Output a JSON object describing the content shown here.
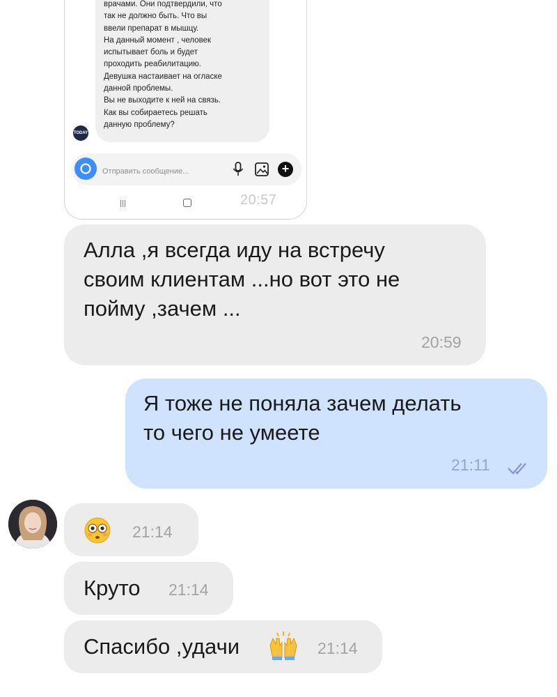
{
  "embedded_screenshot": {
    "message_lines": [
      "врачами. Они подтвердили, что",
      "так не должно быть. Что вы",
      "ввели препарат в мышцу.",
      "На данный момент , человек",
      "испытывает боль и  будет",
      "проходить реабилитацию.",
      "Девушка настаивает на огласке",
      "данной проблемы.",
      "Вы не выходите к ней на связь.",
      "Как вы собираетесь решать",
      "данную проблему?"
    ],
    "avatar_label": "TODAY",
    "input_placeholder": "Отправить сообщение...",
    "time": "20:57",
    "icons": [
      "camera-icon",
      "microphone-icon",
      "gallery-icon",
      "plus-icon",
      "nav-back-icon",
      "nav-home-icon"
    ]
  },
  "messages": [
    {
      "direction": "incoming",
      "lines": [
        "Алла ,я всегда иду на встречу",
        "своим клиентам ...но вот это не",
        "пойму ,зачем ..."
      ],
      "time": "20:59"
    },
    {
      "direction": "outgoing",
      "lines": [
        "Я тоже не поняла зачем делать",
        "то чего не умеете"
      ],
      "time": "21:11",
      "status": "read"
    },
    {
      "direction": "incoming",
      "emoji": "😳",
      "time": "21:14"
    },
    {
      "direction": "incoming",
      "text": "Круто",
      "time": "21:14"
    },
    {
      "direction": "incoming",
      "text": "Спасибо ,удачи",
      "emoji": "🙌",
      "time": "21:14"
    }
  ],
  "colors": {
    "incoming_bubble": "#ececec",
    "outgoing_bubble": "#cfe3ff",
    "read_ticks": "#8a8ee0",
    "camera_button": "#3e8ef7"
  }
}
